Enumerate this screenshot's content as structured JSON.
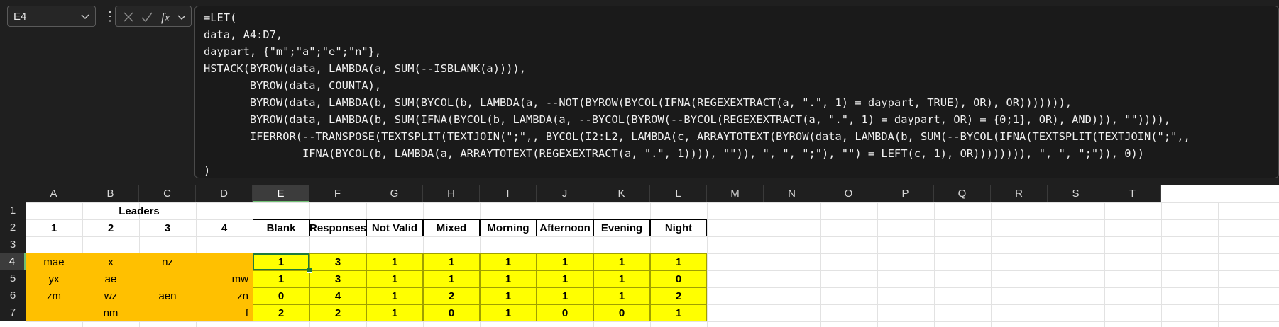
{
  "name_box": {
    "value": "E4"
  },
  "formula_bar": {
    "lines": [
      "=LET(",
      "data, A4:D7,",
      "daypart, {\"m\";\"a\";\"e\";\"n\"},",
      "HSTACK(BYROW(data, LAMBDA(a, SUM(--ISBLANK(a)))),",
      "       BYROW(data, COUNTA),",
      "       BYROW(data, LAMBDA(b, SUM(BYCOL(b, LAMBDA(a, --NOT(BYROW(BYCOL(IFNA(REGEXEXTRACT(a, \".\", 1) = daypart, TRUE), OR), OR))))))),",
      "       BYROW(data, LAMBDA(b, SUM(IFNA(BYCOL(b, LAMBDA(a, --BYCOL(BYROW(--BYCOL(REGEXEXTRACT(a, \".\", 1) = daypart, OR) = {0;1}, OR), AND))), \"\")))),",
      "       IFERROR(--TRANSPOSE(TEXTSPLIT(TEXTJOIN(\";\",, BYCOL(I2:L2, LAMBDA(c, ARRAYTOTEXT(BYROW(data, LAMBDA(b, SUM(--BYCOL(IFNA(TEXTSPLIT(TEXTJOIN(\";\",,",
      "               IFNA(BYCOL(b, LAMBDA(a, ARRAYTOTEXT(REGEXEXTRACT(a, \".\", 1)))), \"\")), \", \", \";\"), \"\") = LEFT(c, 1), OR)))))))), \", \", \";\")), 0))",
      ")"
    ]
  },
  "columns": [
    "A",
    "B",
    "C",
    "D",
    "E",
    "F",
    "G",
    "H",
    "I",
    "J",
    "K",
    "L",
    "M",
    "N",
    "O",
    "P",
    "Q",
    "R",
    "S",
    "T"
  ],
  "rows": [
    "1",
    "2",
    "3",
    "4",
    "5",
    "6",
    "7"
  ],
  "sheet": {
    "title": "Leaders",
    "leader_numbers": [
      "1",
      "2",
      "3",
      "4"
    ],
    "result_headers": [
      "Blank",
      "Responses",
      "Not Valid",
      "Mixed",
      "Morning",
      "Afternoon",
      "Evening",
      "Night"
    ],
    "data": [
      [
        "mae",
        "x",
        "nz",
        ""
      ],
      [
        "yx",
        "ae",
        "",
        "mw"
      ],
      [
        "zm",
        "wz",
        "aen",
        "zn"
      ],
      [
        "",
        "nm",
        "",
        "f"
      ]
    ],
    "results": [
      [
        "1",
        "3",
        "1",
        "1",
        "1",
        "1",
        "1",
        "1"
      ],
      [
        "1",
        "3",
        "1",
        "1",
        "1",
        "1",
        "1",
        "0"
      ],
      [
        "0",
        "4",
        "1",
        "2",
        "1",
        "1",
        "1",
        "2"
      ],
      [
        "2",
        "2",
        "1",
        "0",
        "1",
        "0",
        "0",
        "1"
      ]
    ]
  },
  "colors": {
    "data_fill": "#ffc000",
    "result_fill": "#ffff00",
    "active_border": "#1e7b3c"
  }
}
